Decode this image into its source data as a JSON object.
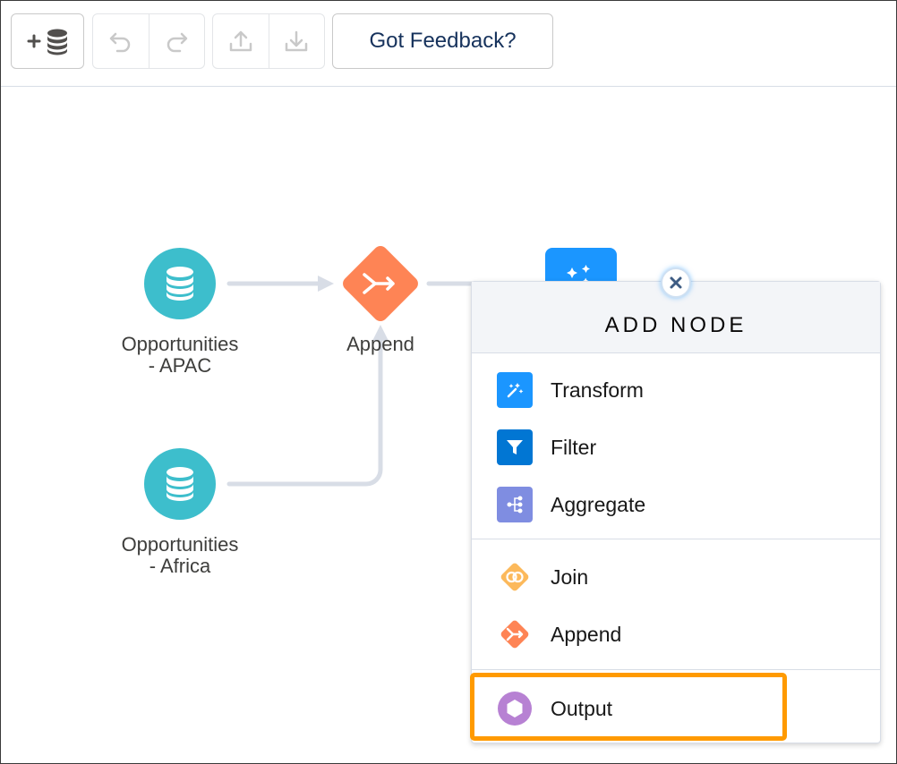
{
  "toolbar": {
    "add_data_icon": "database-plus-icon",
    "undo_icon": "undo-icon",
    "redo_icon": "redo-icon",
    "upload_icon": "upload-icon",
    "download_icon": "download-icon",
    "feedback_label": "Got Feedback?"
  },
  "canvas": {
    "nodes": {
      "apac": {
        "label_line1": "Opportunities",
        "label_line2": "- APAC"
      },
      "africa": {
        "label_line1": "Opportunities",
        "label_line2": "- Africa"
      },
      "append": {
        "label": "Append"
      }
    },
    "colors": {
      "dataset": "#3dbecc",
      "append": "#fe8455",
      "transform": "#1b96ff",
      "connector": "#d8dde6"
    }
  },
  "add_node_menu": {
    "title": "ADD NODE",
    "close_icon": "close-icon",
    "items": [
      {
        "label": "Transform",
        "icon": "magic-wand-icon",
        "color": "#1b96ff"
      },
      {
        "label": "Filter",
        "icon": "filter-icon",
        "color": "#0176d3"
      },
      {
        "label": "Aggregate",
        "icon": "aggregate-icon",
        "color": "#7f8de1"
      },
      {
        "label": "Join",
        "icon": "join-icon",
        "color": "#fcb95b"
      },
      {
        "label": "Append",
        "icon": "append-icon",
        "color": "#fe8455"
      },
      {
        "label": "Output",
        "icon": "output-icon",
        "color": "#b781d3"
      }
    ],
    "highlight_color": "#ff9a00"
  }
}
